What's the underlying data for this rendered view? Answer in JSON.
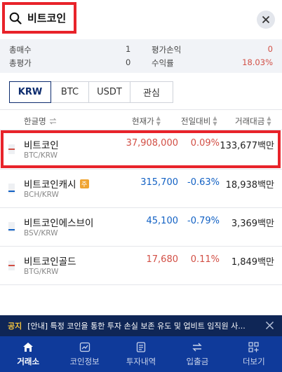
{
  "search": {
    "query": "비트코인"
  },
  "summary": {
    "total_buy_label": "총매수",
    "total_buy_value": "1",
    "total_eval_label": "총평가",
    "total_eval_value": "0",
    "pnl_label": "평가손익",
    "pnl_value": "0",
    "return_label": "수익률",
    "return_value": "18.03%"
  },
  "tabs": [
    "KRW",
    "BTC",
    "USDT",
    "관심"
  ],
  "columns": {
    "name": "한글명",
    "price": "현재가",
    "change": "전일대비",
    "volume": "거래대금"
  },
  "coins": [
    {
      "name": "비트코인",
      "pair": "BTC/KRW",
      "price": "37,908,000",
      "change": "0.09%",
      "volume": "133,677백만",
      "direction": "up",
      "badge": ""
    },
    {
      "name": "비트코인캐시",
      "pair": "BCH/KRW",
      "price": "315,700",
      "change": "-0.63%",
      "volume": "18,938백만",
      "direction": "down",
      "badge": "주"
    },
    {
      "name": "비트코인에스브이",
      "pair": "BSV/KRW",
      "price": "45,100",
      "change": "-0.79%",
      "volume": "3,369백만",
      "direction": "down",
      "badge": ""
    },
    {
      "name": "비트코인골드",
      "pair": "BTG/KRW",
      "price": "17,680",
      "change": "0.11%",
      "volume": "1,849백만",
      "direction": "up",
      "badge": ""
    }
  ],
  "notice": {
    "label": "공지",
    "text": "[안내] 특정 코인을 통한 투자 손실 보존 유도 및 업비트 임직원 사..."
  },
  "nav": [
    {
      "label": "거래소",
      "icon": "home-icon"
    },
    {
      "label": "코인정보",
      "icon": "chart-icon"
    },
    {
      "label": "투자내역",
      "icon": "document-icon"
    },
    {
      "label": "입출금",
      "icon": "transfer-icon"
    },
    {
      "label": "더보기",
      "icon": "more-grid-icon"
    }
  ],
  "colors": {
    "up": "#d24f45",
    "down": "#1261c4",
    "nav_bg": "#0f3a9a",
    "notice_bg": "#0f2656",
    "highlight": "#e8232a"
  }
}
